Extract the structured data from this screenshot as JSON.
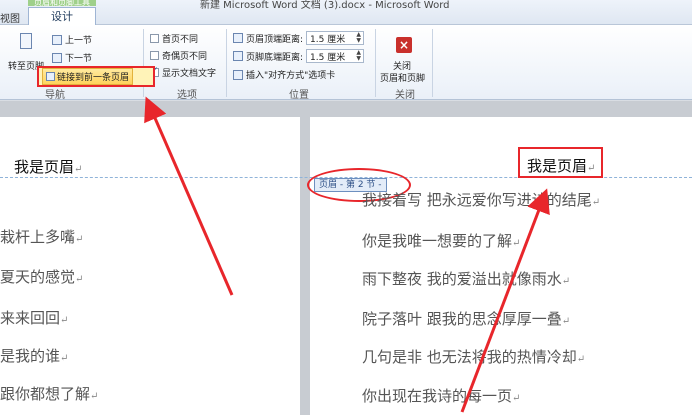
{
  "titlebar": {
    "context_tab_group": "页眉和页脚工具",
    "tab_left": "视图",
    "tab_design": "设计",
    "doc_title": "新建 Microsoft Word 文档 (3).docx - Microsoft Word"
  },
  "ribbon": {
    "navigation": {
      "goto_header": "转至页脚",
      "prev_section": "上一节",
      "next_section": "下一节",
      "link_to_previous": "链接到前一条页眉",
      "label": "导航"
    },
    "options": {
      "first_page_different": "首页不同",
      "odd_even_different": "奇偶页不同",
      "show_document_text": "显示文档文字",
      "label": "选项"
    },
    "position": {
      "header_from_top_label": "页眉顶端距离:",
      "header_from_top_value": "1.5 厘米",
      "footer_from_bottom_label": "页脚底端距离:",
      "footer_from_bottom_value": "1.5 厘米",
      "insert_align_tab": "插入\"对齐方式\"选项卡",
      "label": "位置"
    },
    "close": {
      "button_line1": "关闭",
      "button_line2": "页眉和页脚",
      "label": "关闭"
    }
  },
  "document": {
    "left_page": {
      "header": "我是页眉",
      "lines": [
        "栽杆上多嘴",
        "夏天的感觉",
        "来来回回",
        "是我的谁",
        "跟你都想了解"
      ]
    },
    "right_page": {
      "header": "我是页眉",
      "section_tag": "页眉 - 第 2 节 -",
      "lines": [
        "我接着写 把永远爱你写进诗的结尾",
        "你是我唯一想要的了解",
        "雨下整夜 我的爱溢出就像雨水",
        "院子落叶 跟我的思念厚厚一叠",
        "几句是非 也无法将我的热情冷却",
        "你出现在我诗的每一页"
      ]
    },
    "paragraph_mark": "↵"
  },
  "colors": {
    "annotation_red": "#e8262b",
    "ribbon_bg": "#eaf0f8",
    "section_tag_bg": "#e3ecf8"
  }
}
